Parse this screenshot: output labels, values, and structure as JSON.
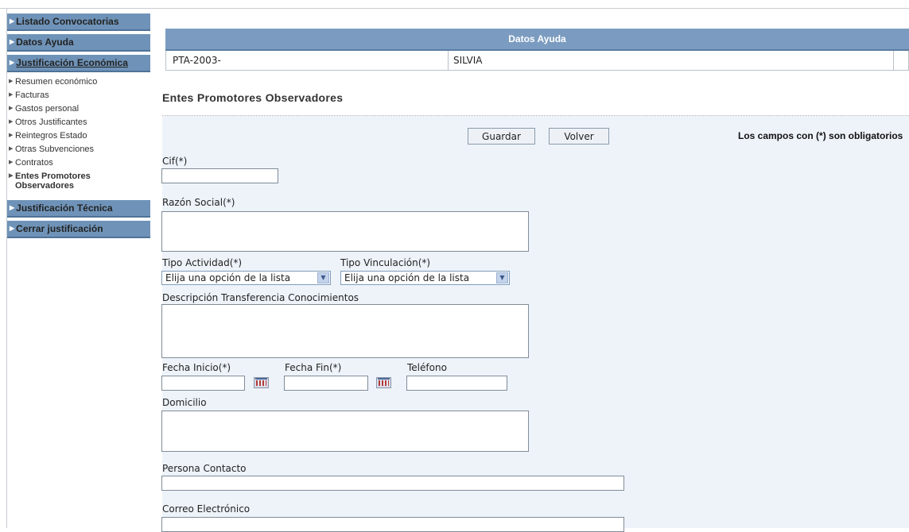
{
  "sidebar": {
    "items": [
      {
        "label": "Listado Convocatorias"
      },
      {
        "label": "Datos Ayuda"
      },
      {
        "label": "Justificación Económica"
      }
    ],
    "subitems": [
      {
        "label": "Resumen económico"
      },
      {
        "label": "Facturas"
      },
      {
        "label": "Gastos personal"
      },
      {
        "label": "Otros Justificantes"
      },
      {
        "label": "Reintegros Estado"
      },
      {
        "label": "Otras Subvenciones"
      },
      {
        "label": "Contratos"
      },
      {
        "label": "Entes Promotores Observadores"
      }
    ],
    "bottom_items": [
      {
        "label": "Justificación Técnica"
      },
      {
        "label": "Cerrar justificación"
      }
    ]
  },
  "datos_ayuda": {
    "header": "Datos Ayuda",
    "code": "PTA-2003-",
    "name": "SILVIA",
    "extra": ""
  },
  "form": {
    "title": "Entes Promotores Observadores",
    "save_label": "Guardar",
    "back_label": "Volver",
    "required_note": "Los campos con (*) son obligatorios",
    "fields": {
      "cif": {
        "label": "Cif(*)",
        "value": ""
      },
      "razon_social": {
        "label": "Razón Social(*)",
        "value": ""
      },
      "tipo_actividad": {
        "label": "Tipo Actividad(*)",
        "selected": "Elija una opción de la lista"
      },
      "tipo_vinculacion": {
        "label": "Tipo Vinculación(*)",
        "selected": "Elija una opción de la lista"
      },
      "descripcion": {
        "label": "Descripción Transferencia Conocimientos",
        "value": ""
      },
      "fecha_inicio": {
        "label": "Fecha Inicio(*)",
        "value": ""
      },
      "fecha_fin": {
        "label": "Fecha Fin(*)",
        "value": ""
      },
      "telefono": {
        "label": "Teléfono",
        "value": ""
      },
      "domicilio": {
        "label": "Domicilio",
        "value": ""
      },
      "persona_contacto": {
        "label": "Persona Contacto",
        "value": ""
      },
      "correo": {
        "label": "Correo Electrónico",
        "value": ""
      }
    }
  },
  "colors": {
    "nav_blue": "#6f93b8",
    "header_blue": "#7b9cc0",
    "panel_bg": "#eef3fa"
  }
}
